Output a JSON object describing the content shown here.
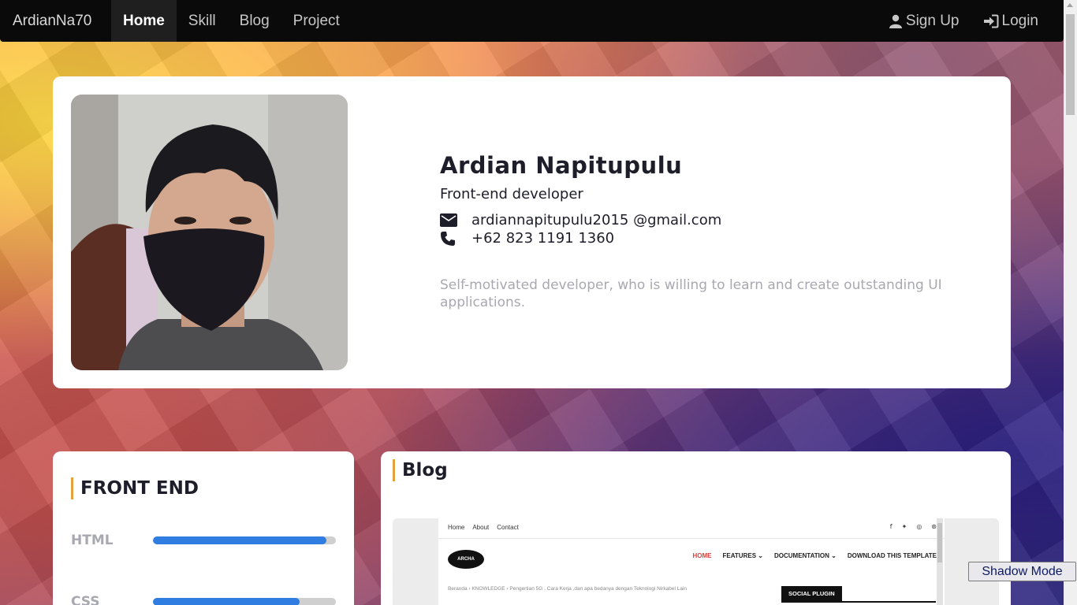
{
  "navbar": {
    "brand": "ArdianNa70",
    "items": [
      {
        "label": "Home",
        "active": true
      },
      {
        "label": "Skill",
        "active": false
      },
      {
        "label": "Blog",
        "active": false
      },
      {
        "label": "Project",
        "active": false
      }
    ],
    "signup_label": "Sign Up",
    "signup_icon": "user-icon",
    "login_label": "Login",
    "login_icon": "sign-in-icon"
  },
  "profile": {
    "name": "Ardian Napitupulu",
    "role": "Front-end developer",
    "email": "ardiannapitupulu2015 @gmail.com",
    "email_icon": "envelope-icon",
    "phone": "+62 823 1191 1360",
    "phone_icon": "phone-icon",
    "bio": "Self-motivated developer, who is willing to learn and create outstanding UI applications.",
    "photo": "profile-photo"
  },
  "skills": {
    "title": "FRONT END",
    "items": [
      {
        "label": "HTML",
        "level": 0.95
      },
      {
        "label": "CSS",
        "level": 0.8
      }
    ]
  },
  "blog": {
    "title": "Blog",
    "preview": {
      "topnav": [
        "Home",
        "About",
        "Contact"
      ],
      "social": [
        "f",
        "t",
        "ig",
        "p"
      ],
      "logo": "ARCHA",
      "menu": [
        "HOME",
        "FEATURES ⌄",
        "DOCUMENTATION ⌄",
        "DOWNLOAD THIS TEMPLATE"
      ],
      "breadcrumb": "Beranda › KNOWLEDGE › Pengertian 5G , Cara Kerja ,dan apa bedanya dengan Teknologi Nirkabel Lain",
      "widget_title": "SOCIAL PLUGIN"
    }
  },
  "shadow_mode_label": "Shadow Mode",
  "colors": {
    "navbar_bg": "#0a0a0a",
    "accent_bar": "#2f7de1",
    "title_accent": "#e0a43a"
  }
}
